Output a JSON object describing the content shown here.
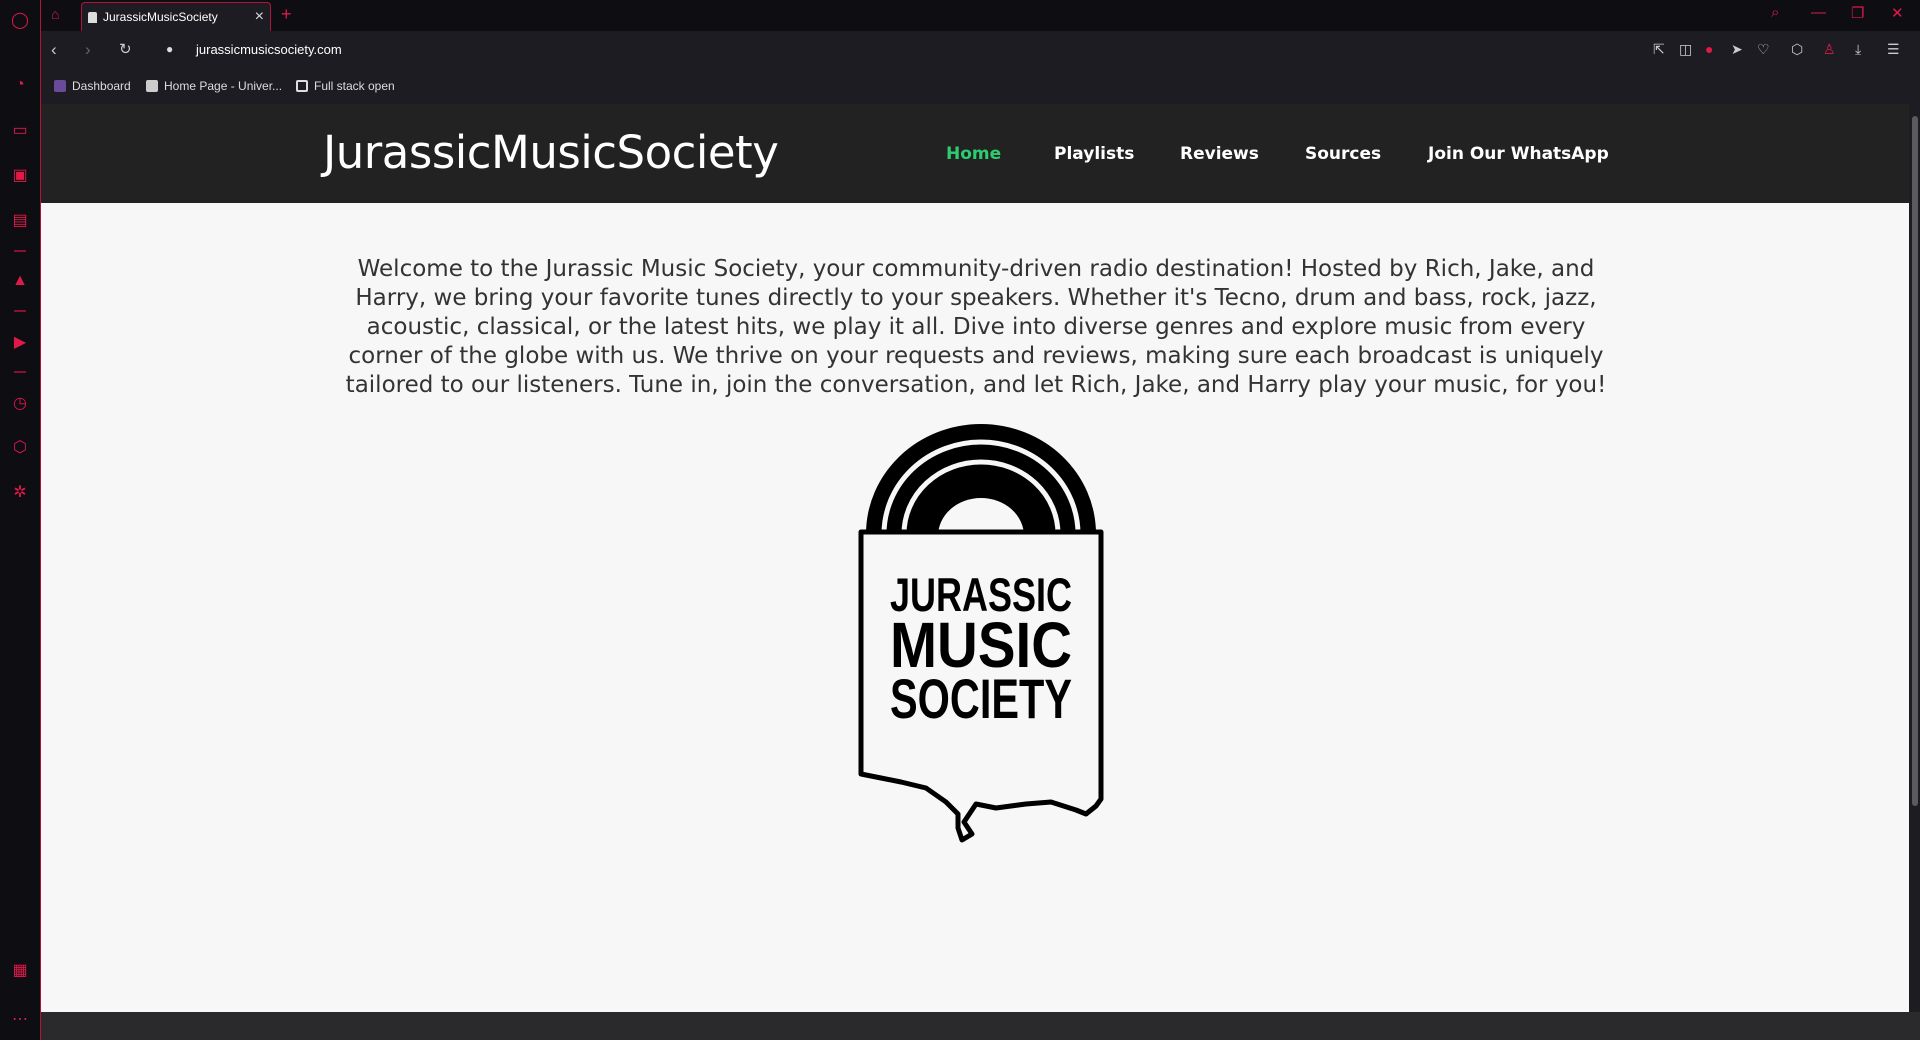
{
  "browser": {
    "tab_title": "JurassicMusicSociety",
    "url": "jurassicmusicsociety.com",
    "bookmarks": [
      "Dashboard",
      "Home Page - Univer...",
      "Full stack open"
    ]
  },
  "site": {
    "title": "JurassicMusicSociety",
    "nav": [
      "Home",
      "Playlists",
      "Reviews",
      "Sources",
      "Join Our WhatsApp"
    ],
    "active_nav": "Home",
    "intro": "Welcome to the Jurassic Music Society, your community-driven radio destination! Hosted by Rich, Jake, and Harry, we bring your favorite tunes directly to your speakers. Whether it's Tecno, drum and bass, rock, jazz, acoustic, classical, or the latest hits, we play it all. Dive into diverse genres and explore music from every corner of the globe with us. We thrive on your requests and reviews, making sure each broadcast is uniquely tailored to our listeners. Tune in, join the conversation, and let Rich, Jake, and Harry play your music, for you!",
    "logo_lines": [
      "JURASSIC",
      "MUSIC",
      "SOCIETY"
    ]
  },
  "colors": {
    "accent": "#e0194a",
    "nav_active": "#2ecc71",
    "header_bg": "#222222"
  }
}
